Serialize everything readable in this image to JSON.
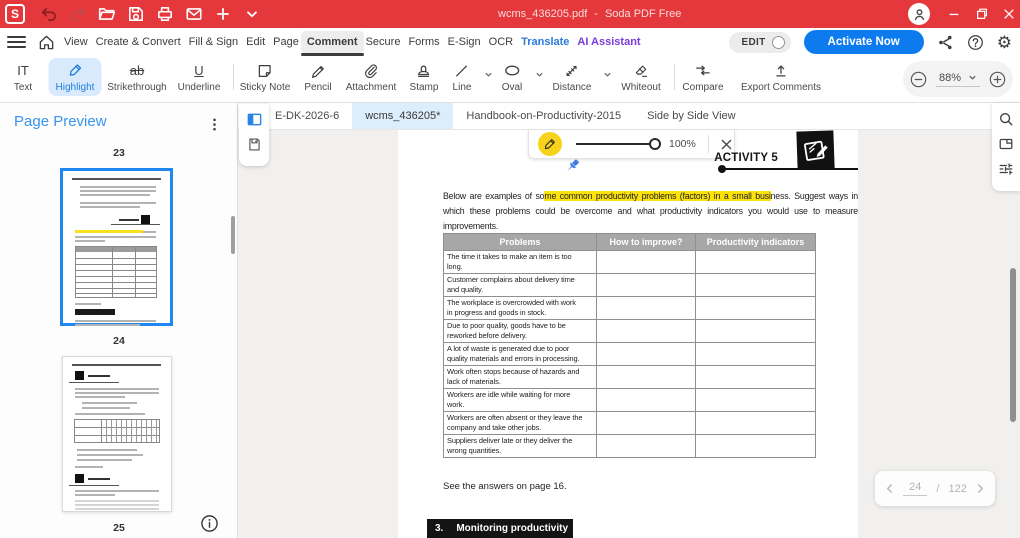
{
  "titlebar": {
    "logo": "S",
    "doc_title": "wcms_436205.pdf",
    "separator": "-",
    "app_name": "Soda PDF Free",
    "icons": [
      "undo",
      "redo",
      "open-folder",
      "save",
      "print",
      "email",
      "add",
      "chevron-down",
      "account",
      "minimize",
      "restore",
      "close"
    ]
  },
  "menubar": {
    "items": [
      {
        "label": "View"
      },
      {
        "label": "Create & Convert"
      },
      {
        "label": "Fill & Sign"
      },
      {
        "label": "Edit"
      },
      {
        "label": "Page"
      },
      {
        "label": "Comment",
        "active": true
      },
      {
        "label": "Secure"
      },
      {
        "label": "Forms"
      },
      {
        "label": "E-Sign"
      },
      {
        "label": "OCR"
      },
      {
        "label": "Translate"
      },
      {
        "label": "AI Assistant"
      }
    ],
    "edit_toggle": "EDIT",
    "activate_button": "Activate Now",
    "help_glyph": "?",
    "right_icons": [
      "share",
      "help",
      "settings"
    ]
  },
  "toolbar": {
    "items": [
      {
        "label": "Text",
        "glyph": "IT"
      },
      {
        "label": "Highlight",
        "active": true
      },
      {
        "label": "Strikethrough",
        "glyph": "ab"
      },
      {
        "label": "Underline",
        "glyph": "U"
      },
      {
        "label": "Sticky Note"
      },
      {
        "label": "Pencil"
      },
      {
        "label": "Attachment"
      },
      {
        "label": "Stamp"
      },
      {
        "label": "Line",
        "chevron": true
      },
      {
        "label": "Oval",
        "chevron": true
      },
      {
        "label": "Distance",
        "chevron": true
      },
      {
        "label": "Whiteout"
      },
      {
        "label": "Compare"
      },
      {
        "label": "Export Comments"
      }
    ],
    "zoom_level": "88%"
  },
  "tabs": {
    "items": [
      {
        "label": "E-DK-2026-6"
      },
      {
        "label": "wcms_436205*",
        "active": true
      },
      {
        "label": "Handbook-on-Productivity-2015"
      },
      {
        "label": "Side by Side View"
      }
    ]
  },
  "sidebar": {
    "title": "Page Preview",
    "pages": [
      {
        "num": "23",
        "selected": true
      },
      {
        "num": "24"
      },
      {
        "num": "25"
      }
    ]
  },
  "document": {
    "hl_toolbar": {
      "opacity": "100%"
    },
    "activity_title": "ACTIVITY 5",
    "paragraph": {
      "pre": "Below are examples of so",
      "highlight": "me common productivity problems (factors) in a small busi",
      "post": "ness. Suggest ways in which these problems could be overcome and what productivity indicators you would use to measure improvements."
    },
    "table": {
      "headers": [
        "Problems",
        "How to improve?",
        "Productivity indicators"
      ],
      "rows": [
        [
          "The time it takes to make an item is too",
          "long."
        ],
        [
          "Customer complains about delivery time",
          "and quality."
        ],
        [
          "The workplace is overcrowded with work",
          "in progress and goods in stock."
        ],
        [
          "Due to poor quality, goods have to be",
          "reworked before delivery."
        ],
        [
          "A lot of waste is generated due to poor",
          "quality materials and errors in processing."
        ],
        [
          "Work often stops because of hazards and",
          "lack of materials."
        ],
        [
          "Workers are idle while waiting for more",
          "work."
        ],
        [
          "Workers are often absent or they leave the",
          "company and take other jobs."
        ],
        [
          "Suppliers deliver late or they deliver the",
          "wrong quantities."
        ]
      ]
    },
    "footer_note": "See the answers on page 16.",
    "section": {
      "num": "3.",
      "title": "Monitoring productivity"
    }
  },
  "pagenav": {
    "current": "24",
    "separator": "/",
    "total": "122"
  }
}
